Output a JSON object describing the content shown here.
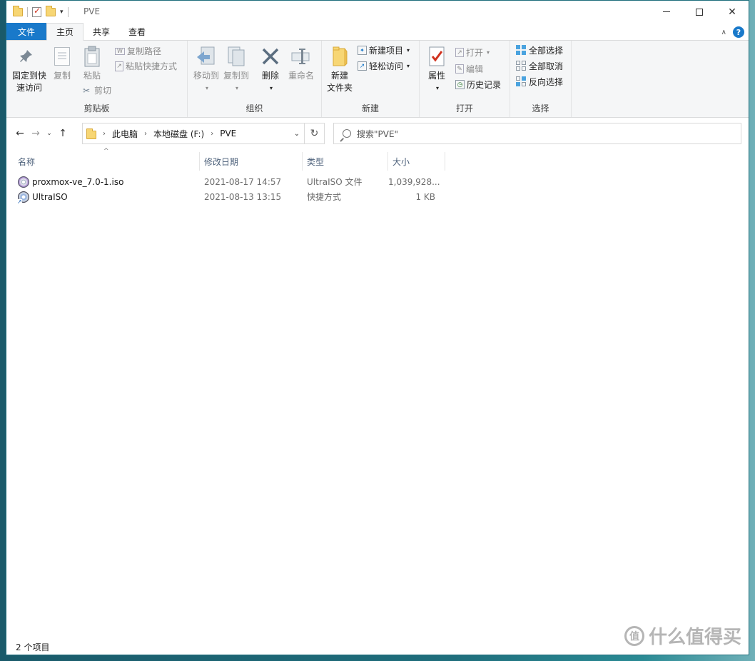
{
  "window": {
    "title": "PVE"
  },
  "tabs": {
    "file": "文件",
    "home": "主页",
    "share": "共享",
    "view": "查看"
  },
  "ribbon": {
    "clipboard": {
      "label": "剪贴板",
      "pin_line1": "固定到快",
      "pin_line2": "速访问",
      "copy": "复制",
      "paste": "粘贴",
      "copy_path": "复制路径",
      "paste_shortcut": "粘贴快捷方式",
      "cut": "剪切"
    },
    "organize": {
      "label": "组织",
      "move_to": "移动到",
      "copy_to": "复制到",
      "delete": "删除",
      "rename": "重命名"
    },
    "new": {
      "label": "新建",
      "new_folder_line1": "新建",
      "new_folder_line2": "文件夹",
      "new_item": "新建项目",
      "easy_access": "轻松访问"
    },
    "open": {
      "label": "打开",
      "properties": "属性",
      "open": "打开",
      "edit": "编辑",
      "history": "历史记录"
    },
    "select": {
      "label": "选择",
      "select_all": "全部选择",
      "select_none": "全部取消",
      "invert": "反向选择"
    }
  },
  "address": {
    "crumbs": [
      "此电脑",
      "本地磁盘 (F:)",
      "PVE"
    ]
  },
  "search": {
    "placeholder": "搜索\"PVE\""
  },
  "columns": {
    "name": "名称",
    "modified": "修改日期",
    "type": "类型",
    "size": "大小"
  },
  "files": [
    {
      "name": "proxmox-ve_7.0-1.iso",
      "modified": "2021-08-17 14:57",
      "type": "UltraISO 文件",
      "size": "1,039,928...",
      "icon": "disc-image-icon"
    },
    {
      "name": "UltraISO",
      "modified": "2021-08-13 13:15",
      "type": "快捷方式",
      "size": "1 KB",
      "icon": "shortcut-icon"
    }
  ],
  "status": {
    "count": "2 个项目"
  },
  "watermark": {
    "text": "什么值得买",
    "logo": "值"
  },
  "colors": {
    "accent": "#1979ca",
    "ribbon_bg": "#f5f6f7",
    "header_text": "#4c607a"
  }
}
